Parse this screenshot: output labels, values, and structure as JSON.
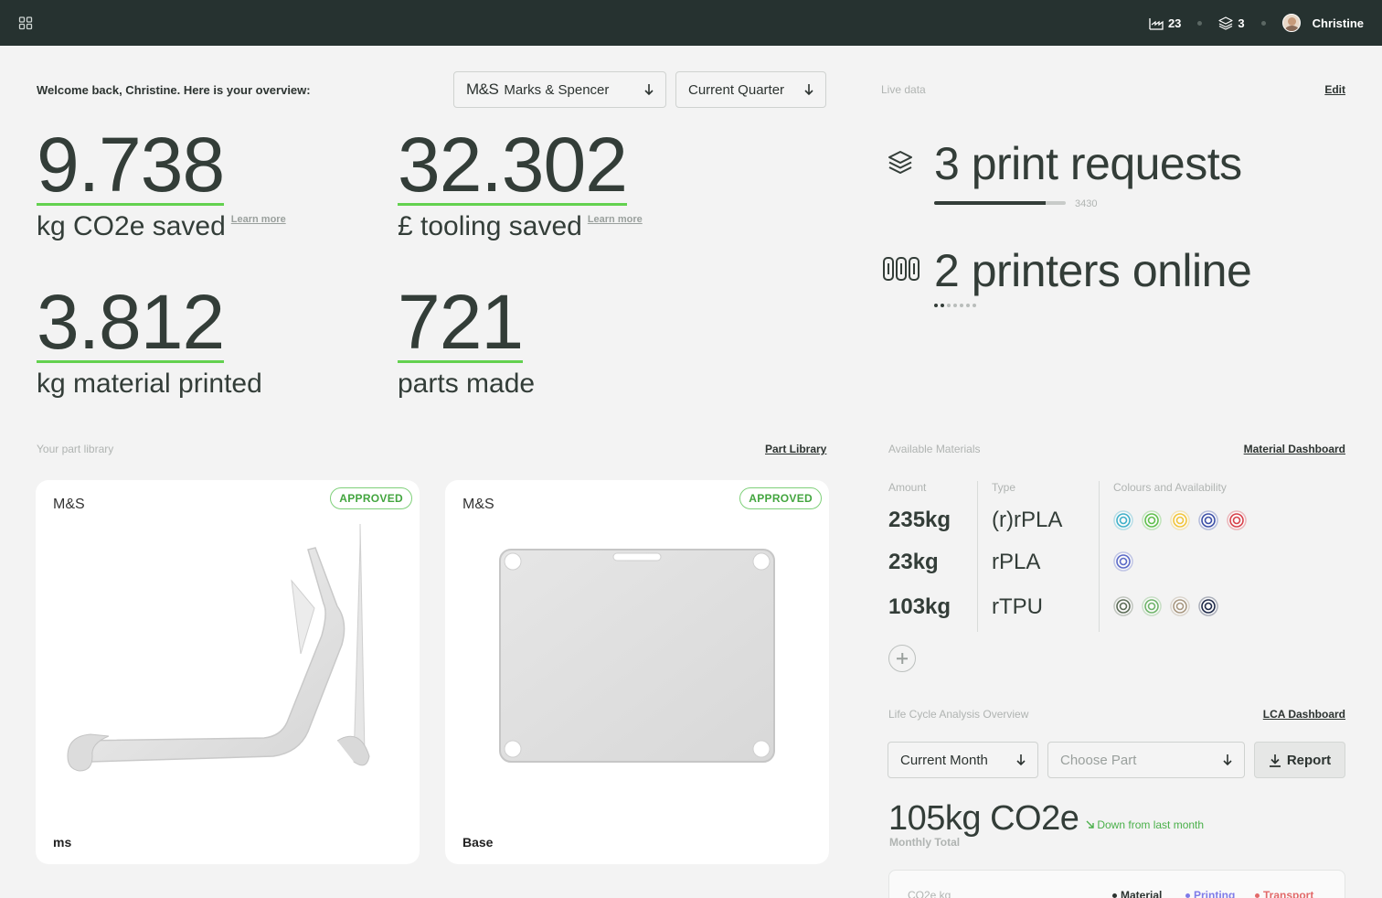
{
  "topbar": {
    "parts_count": "23",
    "prints_count": "3",
    "user_name": "Christine"
  },
  "header": {
    "welcome": "Welcome back, Christine. Here is your overview:",
    "brand_logo": "M&S",
    "brand_select": "Marks & Spencer",
    "period_select": "Current Quarter"
  },
  "stats": [
    {
      "value": "9.738",
      "label": "kg CO2e saved",
      "link": "Learn more"
    },
    {
      "value": "32.302",
      "label": "£ tooling saved",
      "link": "Learn more"
    },
    {
      "value": "3.812",
      "label": "kg material printed"
    },
    {
      "value": "721",
      "label": "parts made"
    }
  ],
  "live": {
    "title": "Live data",
    "edit": "Edit",
    "requests_text": "3 print requests",
    "requests_progress": 0.85,
    "requests_max": "3430",
    "printers_text": "2 printers online",
    "printers_online": 2,
    "printers_total": 7
  },
  "library": {
    "title": "Your part library",
    "link": "Part Library",
    "cards": [
      {
        "brand": "M&S",
        "status": "APPROVED",
        "name": "ms"
      },
      {
        "brand": "M&S",
        "status": "APPROVED",
        "name": "Base"
      }
    ]
  },
  "materials": {
    "title": "Available Materials",
    "link": "Material Dashboard",
    "col_amount": "Amount",
    "col_type": "Type",
    "col_colours": "Colours and Availability",
    "rows": [
      {
        "amount": "235kg",
        "type": "(r)rPLA",
        "colours": [
          "#3fb0c9",
          "#5fbf4c",
          "#f1c43a",
          "#3b4fa8",
          "#d8404a"
        ]
      },
      {
        "amount": "23kg",
        "type": "rPLA",
        "colours": [
          "#5b6ac7"
        ]
      },
      {
        "amount": "103kg",
        "type": "rTPU",
        "colours": [
          "#5b6b56",
          "#6fb36a",
          "#a89780",
          "#1f2a4a"
        ]
      }
    ]
  },
  "lca": {
    "title": "Life Cycle Analysis Overview",
    "link": "LCA Dashboard",
    "period_select": "Current Month",
    "part_select": "Choose Part",
    "report": "Report",
    "total": "105kg CO2e",
    "trend": "Down from last month",
    "subtitle": "Monthly Total",
    "chart_ylabel": "CO2e kg",
    "legend": [
      {
        "name": "Material",
        "color": "#2c3330"
      },
      {
        "name": "Printing",
        "color": "#7f7be8"
      },
      {
        "name": "Transport",
        "color": "#e26a6a"
      }
    ]
  }
}
